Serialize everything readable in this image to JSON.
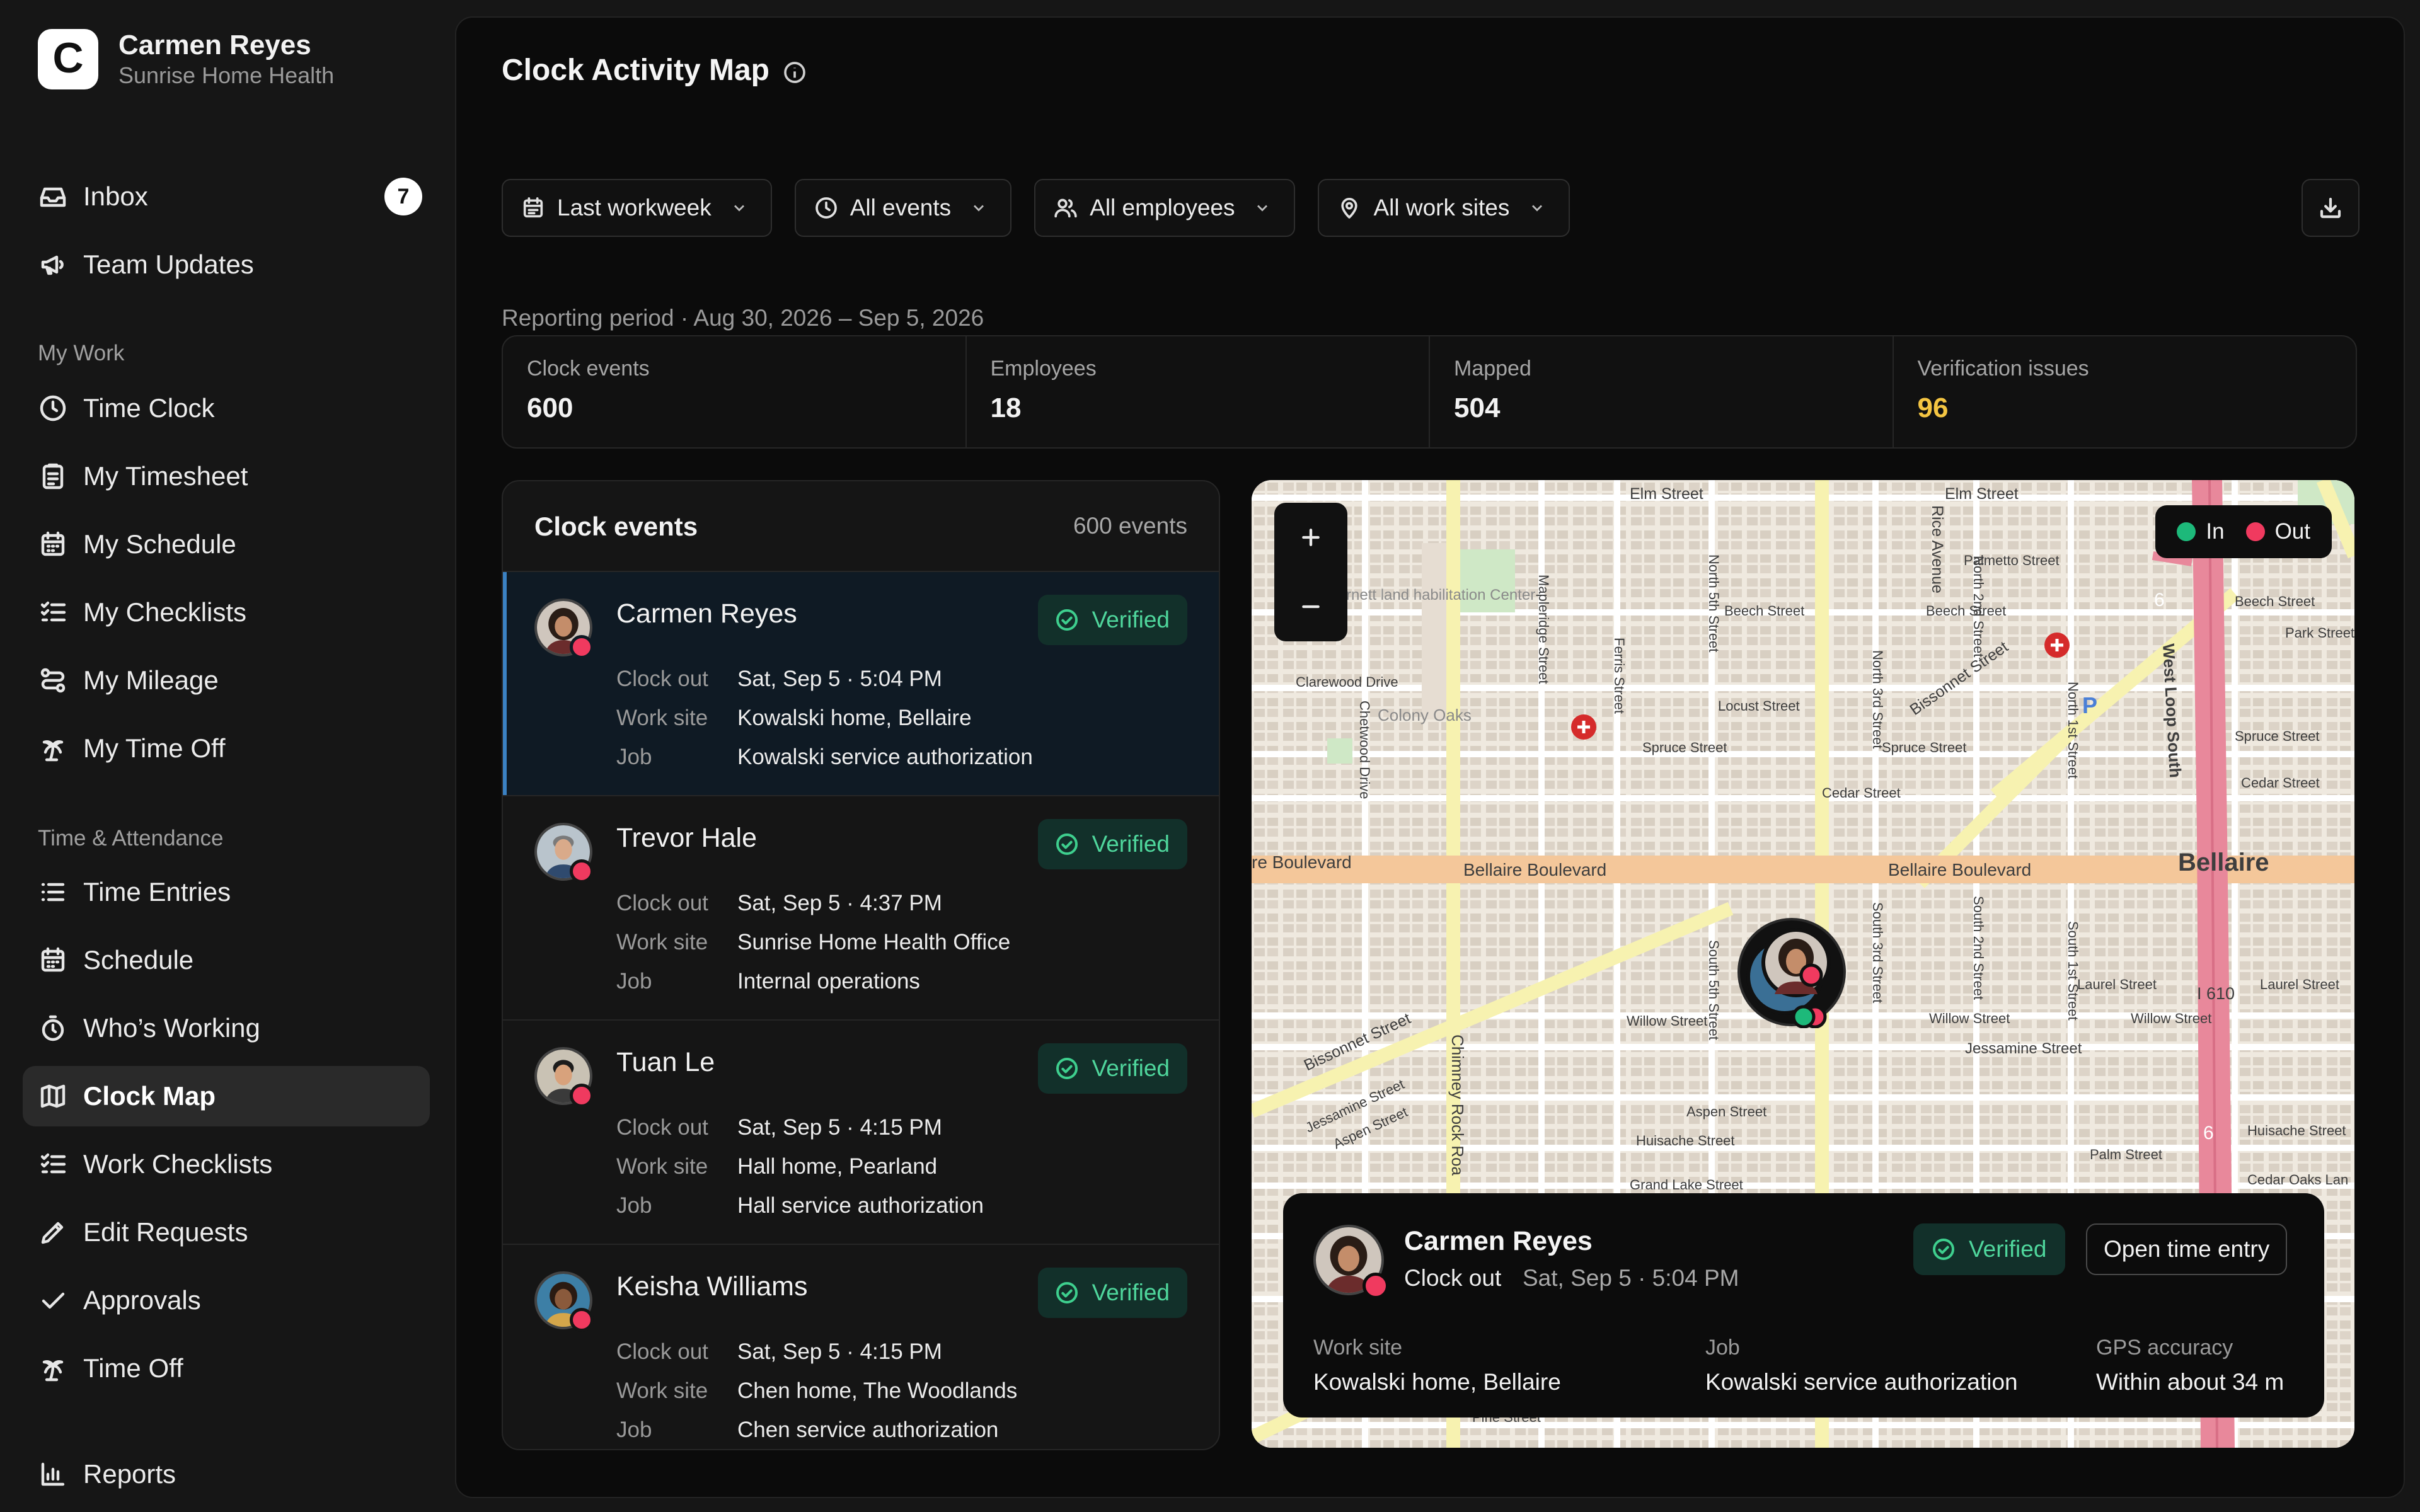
{
  "user": {
    "initial": "C",
    "name": "Carmen Reyes",
    "org": "Sunrise Home Health"
  },
  "nav": {
    "top": [
      {
        "label": "Inbox",
        "badge": "7",
        "icon": "inbox-icon"
      },
      {
        "label": "Team Updates",
        "icon": "megaphone-icon"
      }
    ],
    "my_work_title": "My Work",
    "my_work": [
      {
        "label": "Time Clock",
        "icon": "clock-icon"
      },
      {
        "label": "My Timesheet",
        "icon": "clipboard-icon"
      },
      {
        "label": "My Schedule",
        "icon": "calendar-icon"
      },
      {
        "label": "My Checklists",
        "icon": "checklist-icon"
      },
      {
        "label": "My Mileage",
        "icon": "route-icon"
      },
      {
        "label": "My Time Off",
        "icon": "palm-tree-icon"
      }
    ],
    "ta_title": "Time & Attendance",
    "ta": [
      {
        "label": "Time Entries",
        "icon": "list-icon"
      },
      {
        "label": "Schedule",
        "icon": "calendar-icon"
      },
      {
        "label": "Who’s Working",
        "icon": "stopwatch-icon"
      },
      {
        "label": "Clock Map",
        "icon": "map-icon",
        "active": true
      },
      {
        "label": "Work Checklists",
        "icon": "checklist-icon"
      },
      {
        "label": "Edit Requests",
        "icon": "pencil-icon"
      },
      {
        "label": "Approvals",
        "icon": "check-icon"
      },
      {
        "label": "Time Off",
        "icon": "palm-tree-icon"
      }
    ],
    "reports": {
      "label": "Reports",
      "icon": "bar-chart-icon"
    }
  },
  "page": {
    "title": "Clock Activity Map",
    "filters": {
      "period": "Last workweek",
      "events": "All events",
      "employees": "All employees",
      "sites": "All work sites"
    },
    "reporting_period": "Reporting period · Aug 30, 2026 – Sep 5, 2026"
  },
  "stats": [
    {
      "label": "Clock events",
      "value": "600"
    },
    {
      "label": "Employees",
      "value": "18"
    },
    {
      "label": "Mapped",
      "value": "504"
    },
    {
      "label": "Verification issues",
      "value": "96"
    }
  ],
  "events_panel": {
    "title": "Clock events",
    "count": "600 events",
    "labels": {
      "action": "Clock out",
      "site": "Work site",
      "job": "Job",
      "status": "Verified"
    },
    "items": [
      {
        "name": "Carmen Reyes",
        "time": "Sat, Sep 5 · 5:04 PM",
        "site": "Kowalski home, Bellaire",
        "job": "Kowalski service authorization"
      },
      {
        "name": "Trevor Hale",
        "time": "Sat, Sep 5 · 4:37 PM",
        "site": "Sunrise Home Health Office",
        "job": "Internal operations"
      },
      {
        "name": "Tuan Le",
        "time": "Sat, Sep 5 · 4:15 PM",
        "site": "Hall home, Pearland",
        "job": "Hall service authorization"
      },
      {
        "name": "Keisha Williams",
        "time": "Sat, Sep 5 · 4:15 PM",
        "site": "Chen home, The Woodlands",
        "job": "Chen service authorization"
      }
    ]
  },
  "map": {
    "legend": {
      "in": "In",
      "out": "Out",
      "in_color": "#1db97a",
      "out_color": "#f03a5f"
    },
    "labels": {
      "elm": "Elm Street",
      "elm2": "Elm Street",
      "rice": "Rice Avenue",
      "palmetto": "Palmetto Street",
      "beech": "Beech Street",
      "beech2": "Beech Street",
      "beech3": "Beech Street",
      "park": "Park Street",
      "bissonnet": "Bissonnet Street",
      "bissonnet2": "Bissonnet Street",
      "west_loop": "West Loop South",
      "clarewood": "Clarewood Drive",
      "locust": "Locust Street",
      "spruce": "Spruce Street",
      "spruce2": "Spruce Street",
      "spruce3": "Spruce Street",
      "cedar": "Cedar Street",
      "cedar2": "Cedar Street",
      "bellaire_blvd": "Bellaire Boulevard",
      "bellaire_blvd2": "Bellaire Boulevard",
      "blvd_left": "re Boulevard",
      "bellaire": "Bellaire",
      "laurel": "Laurel Street",
      "laurel2": "Laurel Street",
      "willow": "Willow Street",
      "willow2": "Willow Street",
      "willow3": "Willow Street",
      "i610": "I 610",
      "jessamine": "Jessamine Street",
      "jessamine2": "Jessamine Street",
      "aspen": "Aspen Street",
      "aspen2": "Aspen Street",
      "huisache": "Huisache Street",
      "huisache2": "Huisache Street",
      "palm": "Palm Street",
      "grand_lake": "Grand Lake Street",
      "cedar_oaks": "Cedar Oaks Lan",
      "colony_oaks": "Colony Oaks",
      "chimney_rock": "Chimney Rock Roa",
      "mapleridge": "Mapleridge Street",
      "ferris": "Ferris Street",
      "n_5th": "North 5th Street",
      "n_3rd": "North 3rd Street",
      "n_2nd": "North 2nd Street",
      "n_1st": "North 1st Street",
      "s_5th": "South 5th Street",
      "s_3rd": "South 3rd Street",
      "s_2nd": "South 2nd Street",
      "s_1st": "South 1st Street",
      "rehab": "rnett land habilitation Center",
      "pine": "Pine Street",
      "chetwood": "Chetwood Drive",
      "route6": "6",
      "parking": "P"
    },
    "popup": {
      "name": "Carmen Reyes",
      "action": "Clock out",
      "time": "Sat, Sep 5 · 5:04 PM",
      "status": "Verified",
      "open_button": "Open time entry",
      "site_label": "Work site",
      "site": "Kowalski home, Bellaire",
      "job_label": "Job",
      "job": "Kowalski service authorization",
      "gps_label": "GPS accuracy",
      "gps": "Within about 34 m"
    }
  }
}
